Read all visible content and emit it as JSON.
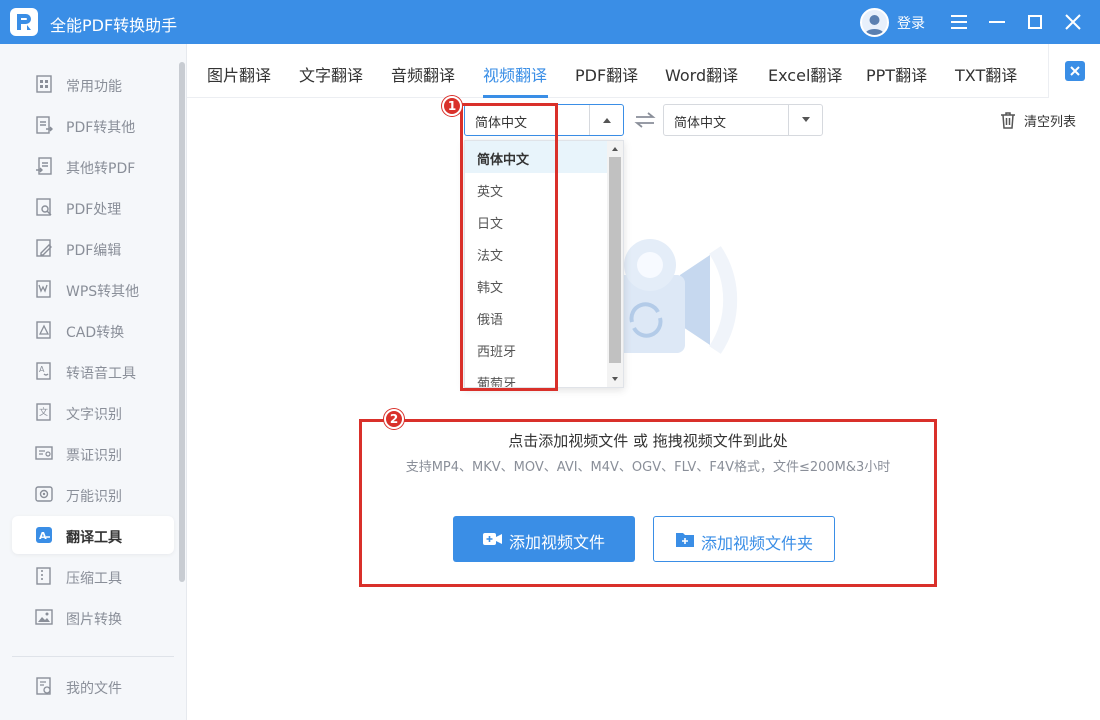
{
  "app": {
    "title": "全能PDF转换助手",
    "login_label": "登录",
    "accent_color": "#3a8ee6"
  },
  "sidebar": {
    "items": [
      {
        "label": "常用功能",
        "icon": "grid-icon"
      },
      {
        "label": "PDF转其他",
        "icon": "pdf-export-icon"
      },
      {
        "label": "其他转PDF",
        "icon": "pdf-import-icon"
      },
      {
        "label": "PDF处理",
        "icon": "pdf-process-icon"
      },
      {
        "label": "PDF编辑",
        "icon": "pdf-edit-icon"
      },
      {
        "label": "WPS转其他",
        "icon": "wps-icon"
      },
      {
        "label": "CAD转换",
        "icon": "cad-icon"
      },
      {
        "label": "转语音工具",
        "icon": "speech-icon"
      },
      {
        "label": "文字识别",
        "icon": "ocr-icon"
      },
      {
        "label": "票证识别",
        "icon": "ticket-icon"
      },
      {
        "label": "万能识别",
        "icon": "recognize-icon"
      },
      {
        "label": "翻译工具",
        "icon": "translate-icon"
      },
      {
        "label": "压缩工具",
        "icon": "compress-icon"
      },
      {
        "label": "图片转换",
        "icon": "image-icon"
      }
    ],
    "active_index": 11,
    "footer_item": {
      "label": "我的文件",
      "icon": "my-files-icon"
    }
  },
  "tabs": {
    "items": [
      "图片翻译",
      "文字翻译",
      "音频翻译",
      "视频翻译",
      "PDF翻译",
      "Word翻译",
      "Excel翻译",
      "PPT翻译",
      "TXT翻译"
    ],
    "active_index": 3
  },
  "translate": {
    "source_lang": "简体中文",
    "target_lang": "简体中文",
    "clear_label": "清空列表",
    "dropdown_options": [
      "简体中文",
      "英文",
      "日文",
      "法文",
      "韩文",
      "俄语",
      "西班牙",
      "葡萄牙"
    ],
    "selected_option_index": 0
  },
  "dropzone": {
    "main_text": "点击添加视频文件 或 拖拽视频文件到此处",
    "sub_text": "支持MP4、MKV、MOV、AVI、M4V、OGV、FLV、F4V格式，文件≤200M&3小时",
    "add_file_label": "添加视频文件",
    "add_folder_label": "添加视频文件夹"
  },
  "annotations": {
    "badge_1": "1",
    "badge_2": "2",
    "color": "#d9302a"
  }
}
